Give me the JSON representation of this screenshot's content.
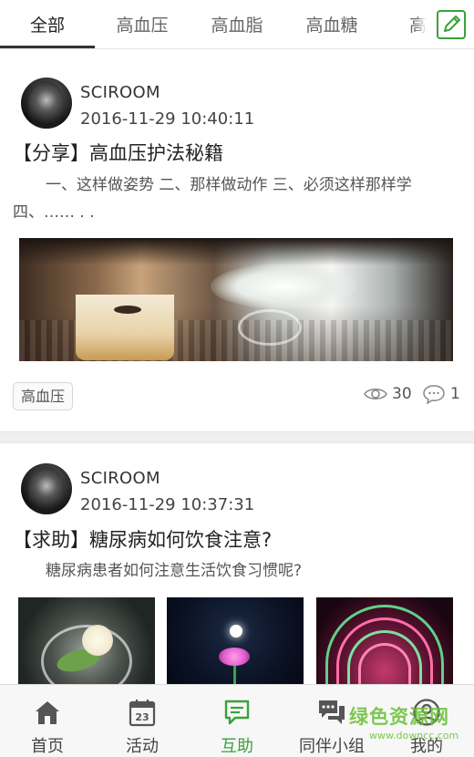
{
  "tabs": [
    {
      "label": "全部",
      "active": true
    },
    {
      "label": "高血压",
      "active": false
    },
    {
      "label": "高血脂",
      "active": false
    },
    {
      "label": "高血糖",
      "active": false
    },
    {
      "label": "高尿",
      "active": false
    }
  ],
  "header": {
    "edit_icon": "edit-icon"
  },
  "posts": [
    {
      "username": "SCIROOM",
      "time": "2016-11-29 10:40:11",
      "title": "【分享】高血压护法秘籍",
      "body": "一、这样做姿势 二、那样做动作 三、必须这样那样学 四、…… . .",
      "tag": "高血压",
      "views": "30",
      "comments": "1"
    },
    {
      "username": "SCIROOM",
      "time": "2016-11-29 10:37:31",
      "title": "【求助】糖尿病如何饮食注意?",
      "body": "糖尿病患者如何注意生活饮食习惯呢?"
    }
  ],
  "bottom_nav": [
    {
      "label": "首页",
      "icon": "home-icon",
      "active": false
    },
    {
      "label": "活动",
      "icon": "calendar-icon",
      "active": false,
      "badge": "23"
    },
    {
      "label": "互助",
      "icon": "chat-icon",
      "active": true
    },
    {
      "label": "同伴小组",
      "icon": "group-chat-icon",
      "active": false
    },
    {
      "label": "我的",
      "icon": "user-icon",
      "active": false
    }
  ],
  "watermark": {
    "text": "绿色资源网",
    "sub": "www.downcc.com"
  },
  "colors": {
    "accent": "#3aa13a",
    "divider": "#efefef"
  }
}
